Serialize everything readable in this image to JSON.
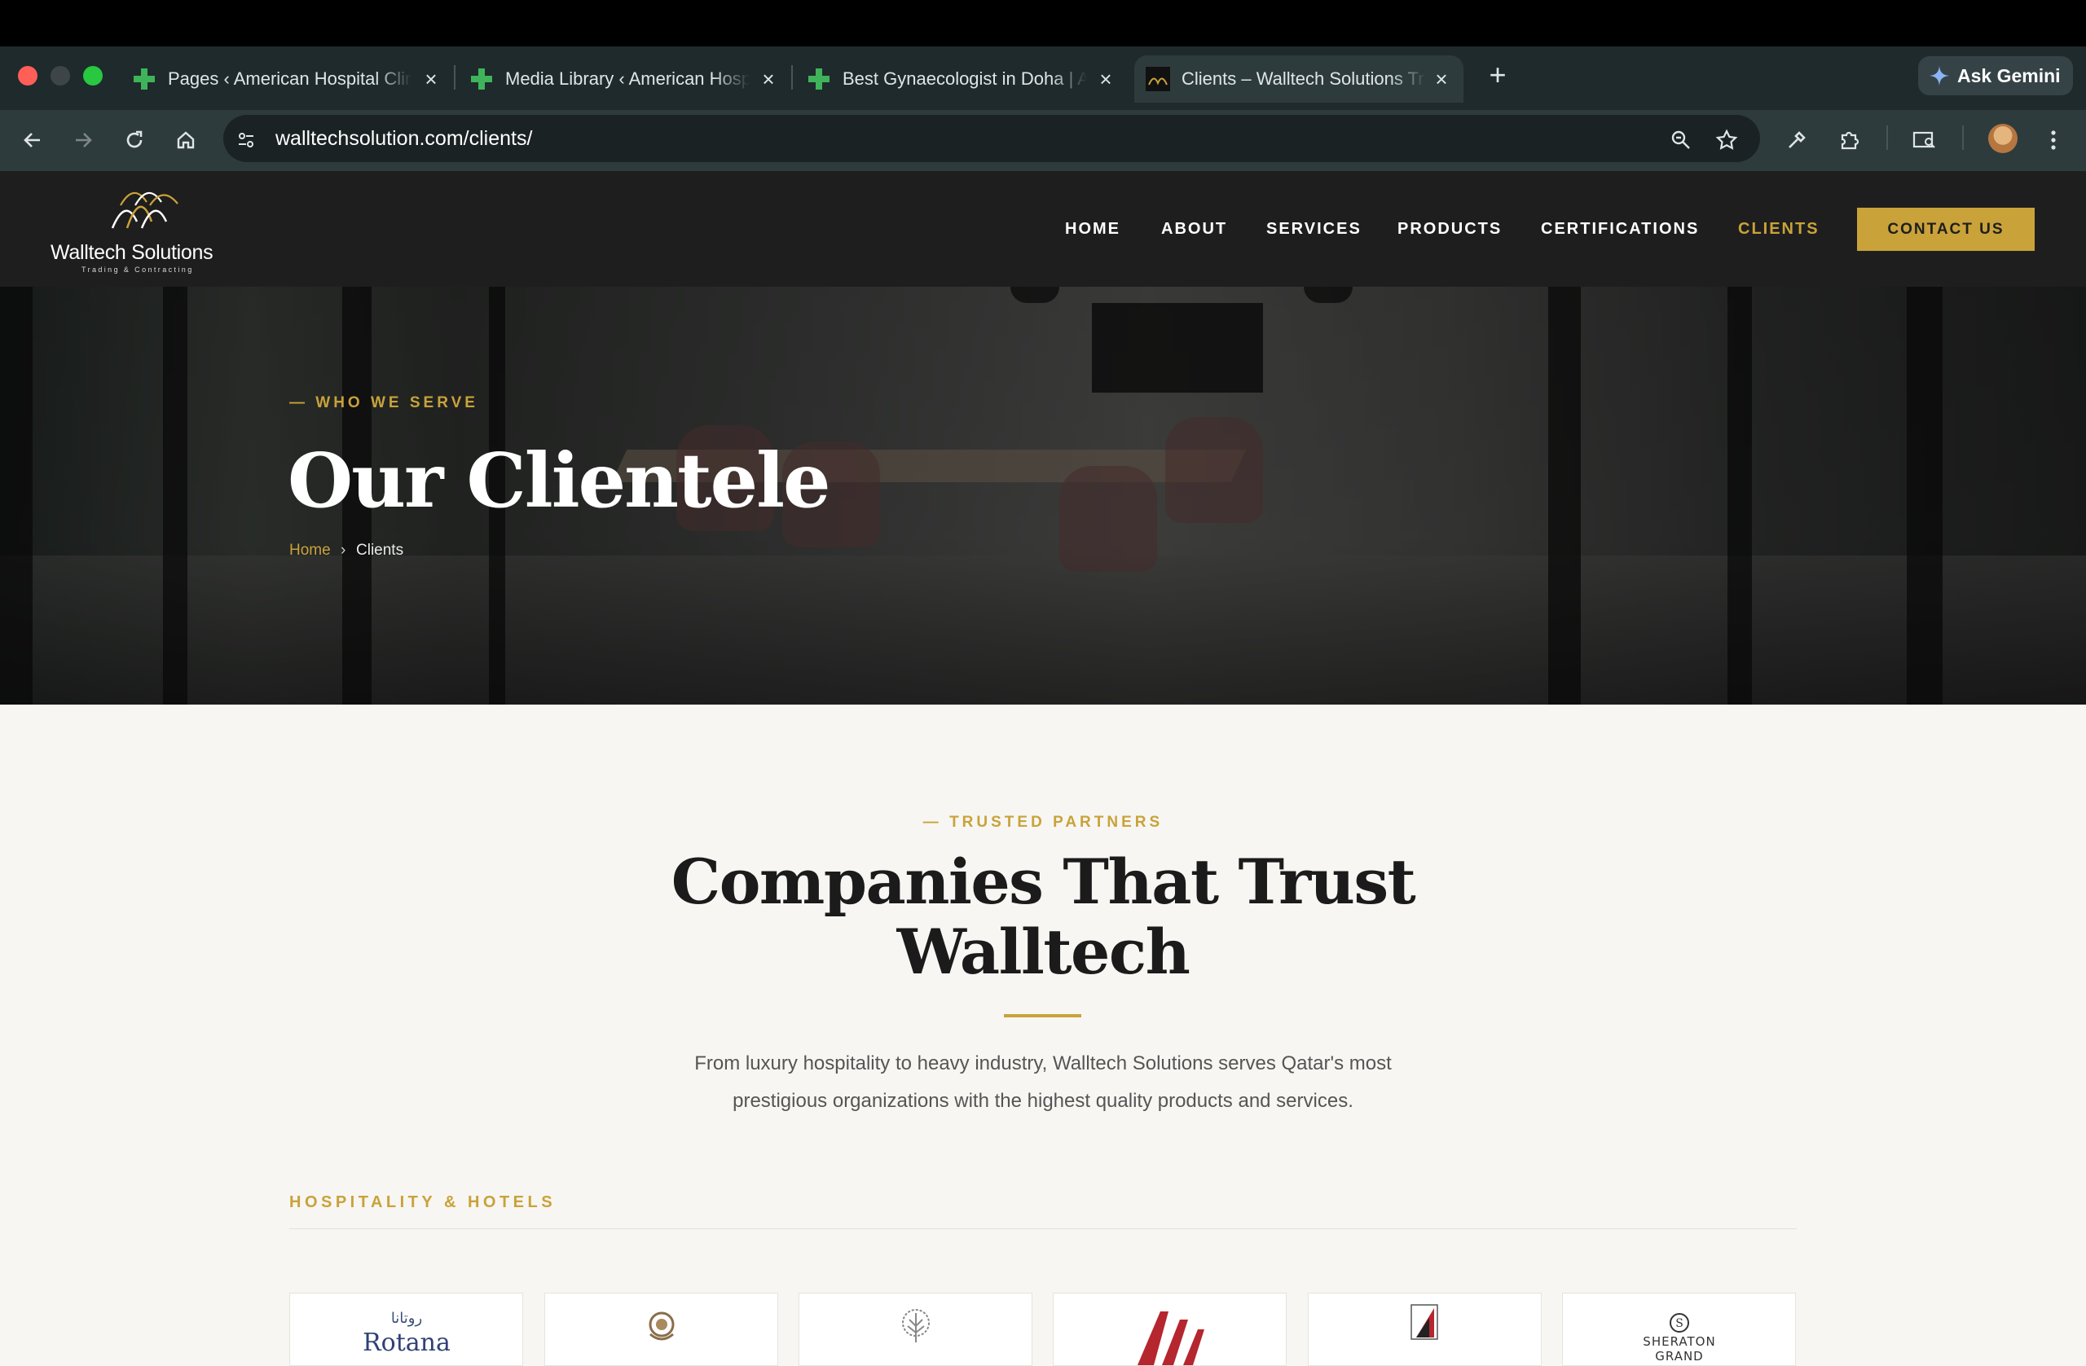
{
  "browser": {
    "tabs": [
      {
        "title": "Pages ‹ American Hospital Clinic",
        "active": false
      },
      {
        "title": "Media Library ‹ American Hospital",
        "active": false
      },
      {
        "title": "Best Gynaecologist in Doha | American",
        "active": false
      },
      {
        "title": "Clients – Walltech Solutions Trading",
        "active": true
      }
    ],
    "new_tab": "+",
    "gemini_label": "Ask Gemini",
    "url_host": "walltechsolution.com",
    "url_path": "/clients/",
    "colors": {
      "chrome_bg": "#1f2a2c",
      "toolbar_bg": "#2e3b3d",
      "omnibox_bg": "#1a2224"
    }
  },
  "site": {
    "logo": {
      "name": "Walltech Solutions",
      "tagline": "Trading & Contracting"
    },
    "nav": [
      {
        "label": "HOME",
        "active": false
      },
      {
        "label": "ABOUT",
        "active": false
      },
      {
        "label": "SERVICES",
        "active": false
      },
      {
        "label": "PRODUCTS",
        "active": false
      },
      {
        "label": "CERTIFICATIONS",
        "active": false
      },
      {
        "label": "CLIENTS",
        "active": true
      }
    ],
    "cta": "CONTACT US",
    "accent_color": "#c9a23a",
    "header_bg": "#1e1e1e"
  },
  "hero": {
    "eyebrow": "— WHO WE SERVE",
    "title": "Our Clientele",
    "breadcrumb": {
      "home": "Home",
      "separator": "›",
      "current": "Clients"
    }
  },
  "main": {
    "eyebrow": "— TRUSTED PARTNERS",
    "title_line1": "Companies That Trust",
    "title_line2": "Walltech",
    "lead_line1": "From luxury hospitality to heavy industry, Walltech Solutions serves Qatar's most",
    "lead_line2": "prestigious organizations with the highest quality products and services.",
    "category": "HOSPITALITY & HOTELS",
    "client_logos": [
      {
        "name": "Rotana",
        "arabic": "روتانا",
        "icon": "rotana-logo"
      },
      {
        "name": "",
        "icon": "crest-logo"
      },
      {
        "name": "",
        "icon": "tree-logo"
      },
      {
        "name": "",
        "icon": "marriott-m-logo"
      },
      {
        "name": "",
        "icon": "sail-logo"
      },
      {
        "name": "SHERATON",
        "sub": "GRAND",
        "icon": "sheraton-logo"
      }
    ]
  }
}
